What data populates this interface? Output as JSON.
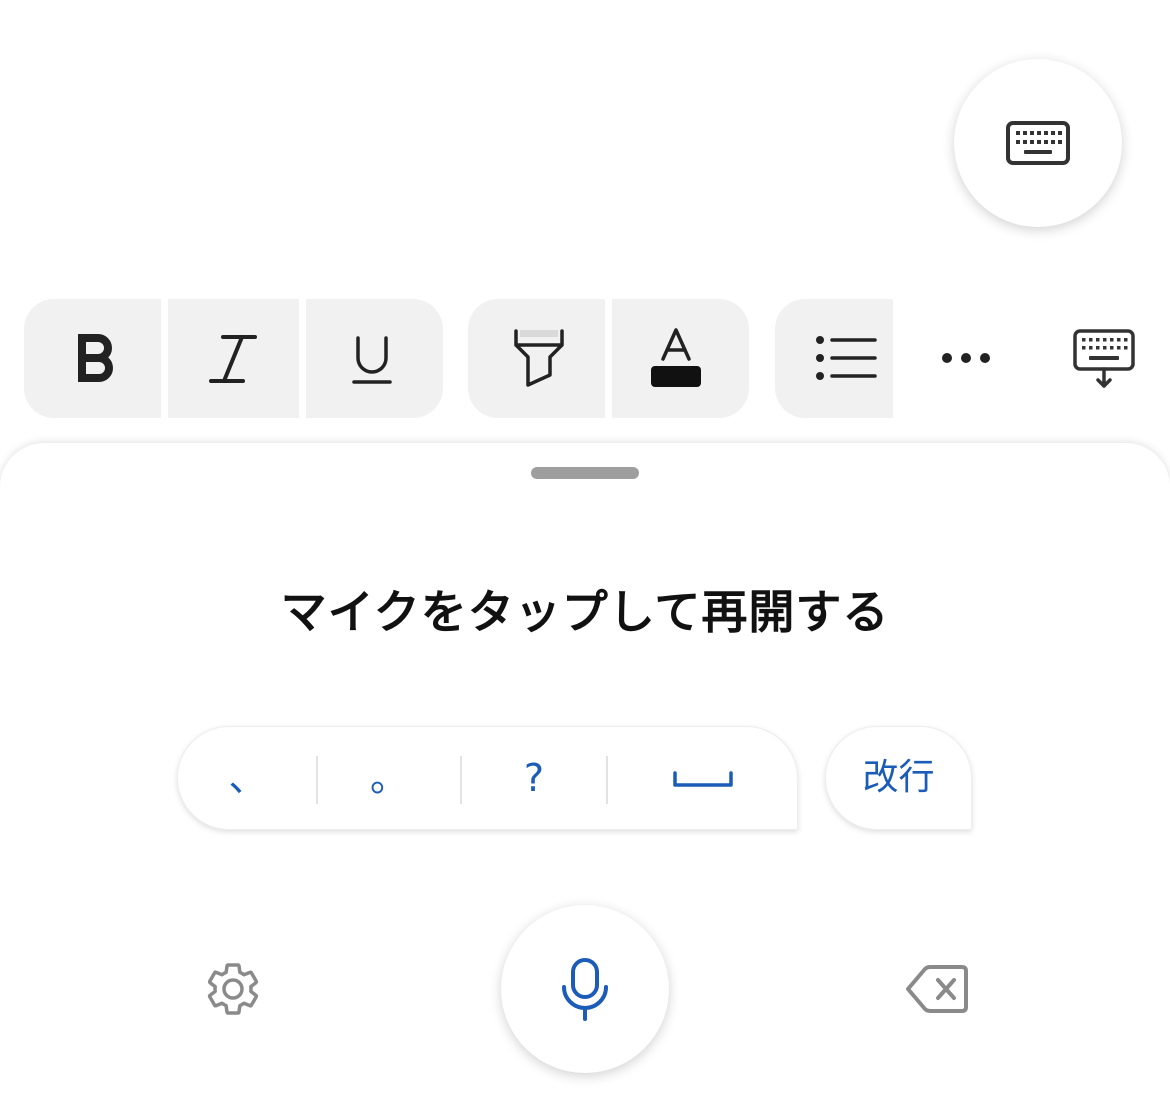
{
  "colors": {
    "accent": "#1a5cb8",
    "icon_gray": "#8a8a8a",
    "toolbar_bg": "#f1f1f1",
    "icon_dark": "#222222"
  },
  "floating_button": {
    "icon": "keyboard-icon"
  },
  "toolbar": {
    "items": [
      {
        "icon": "bold-icon"
      },
      {
        "icon": "italic-icon"
      },
      {
        "icon": "underline-icon"
      },
      {
        "icon": "highlighter-icon"
      },
      {
        "icon": "font-color-icon"
      },
      {
        "icon": "bulleted-list-icon"
      },
      {
        "icon": "more-icon"
      },
      {
        "icon": "keyboard-dismiss-icon"
      }
    ]
  },
  "dictation": {
    "prompt": "マイクをタップして再開する",
    "punctuation": [
      "、",
      "。",
      "?"
    ],
    "space_icon": "space-icon",
    "newline_label": "改行",
    "settings_icon": "gear-icon",
    "mic_icon": "microphone-icon",
    "backspace_icon": "backspace-icon"
  }
}
